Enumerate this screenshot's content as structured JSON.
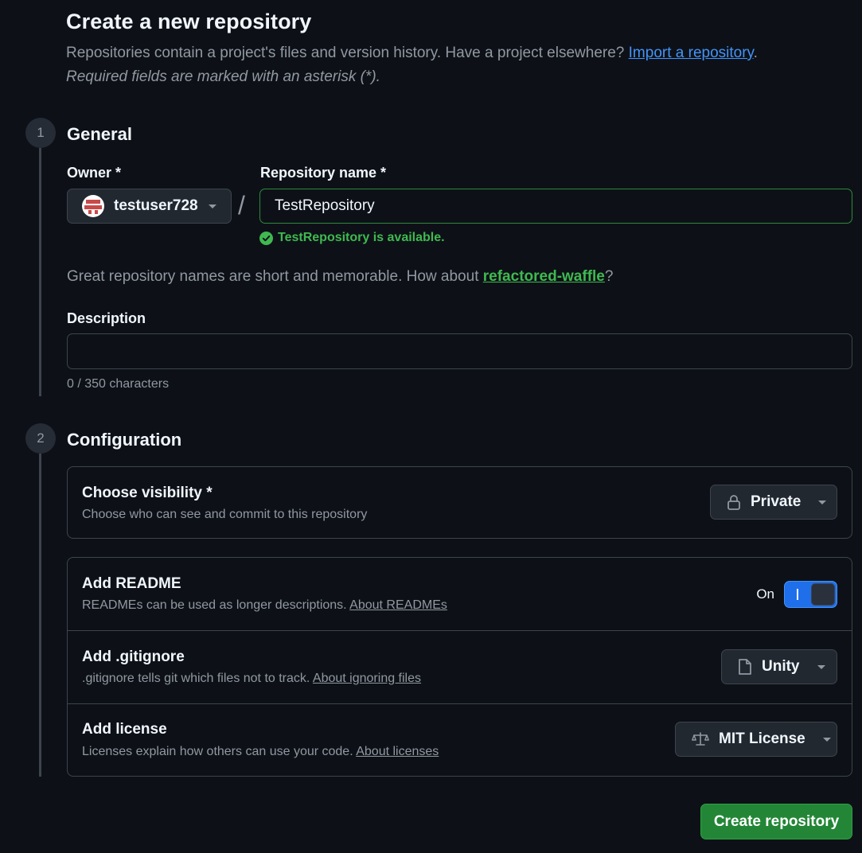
{
  "header": {
    "title": "Create a new repository",
    "intro_text": "Repositories contain a project's files and version history. Have a project elsewhere?",
    "import_link": "Import a repository",
    "intro_end": ".",
    "required_note": "Required fields are marked with an asterisk (*)."
  },
  "steps": [
    {
      "number": "1",
      "title": "General"
    },
    {
      "number": "2",
      "title": "Configuration"
    }
  ],
  "general": {
    "owner_label": "Owner *",
    "owner_value": "testuser728",
    "slash": "/",
    "repo_name_label": "Repository name *",
    "repo_name_value": "TestRepository",
    "availability": "TestRepository is available.",
    "suggestion_text": "Great repository names are short and memorable. How about",
    "suggestion_link": "refactored-waffle",
    "suggestion_end": "?",
    "description_label": "Description",
    "description_value": "",
    "char_count": "0 / 350 characters"
  },
  "configuration": {
    "visibility": {
      "title": "Choose visibility *",
      "subtitle": "Choose who can see and commit to this repository",
      "value": "Private",
      "icon": "lock-icon"
    },
    "readme": {
      "title": "Add README",
      "subtitle": "READMEs can be used as longer descriptions.",
      "link": "About READMEs",
      "toggle_label": "On",
      "toggle_state": "on"
    },
    "gitignore": {
      "title": "Add .gitignore",
      "subtitle": ".gitignore tells git which files not to track.",
      "link": "About ignoring files",
      "value": "Unity",
      "icon": "file-icon"
    },
    "license": {
      "title": "Add license",
      "subtitle": "Licenses explain how others can use your code.",
      "link": "About licenses",
      "value": "MIT License",
      "icon": "law-icon"
    }
  },
  "actions": {
    "create_label": "Create repository"
  },
  "colors": {
    "background": "#0d1117",
    "success": "#3fb950",
    "link": "#4493f8",
    "primary_button": "#238636",
    "toggle_on": "#1f6feb"
  }
}
